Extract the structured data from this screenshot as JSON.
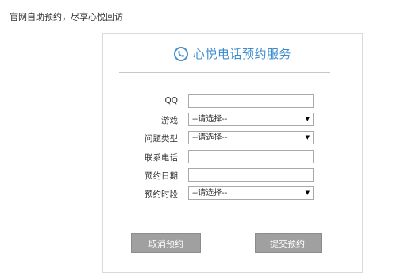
{
  "page": {
    "heading": "官网自助预约，尽享心悦回访"
  },
  "card": {
    "title": "心悦电话预约服务",
    "icon": "phone-icon",
    "accent_color": "#3e8ccf"
  },
  "form": {
    "qq": {
      "label": "QQ",
      "value": ""
    },
    "game": {
      "label": "游戏",
      "selected": "--请选择--"
    },
    "issue_type": {
      "label": "问题类型",
      "selected": "--请选择--"
    },
    "phone": {
      "label": "联系电话",
      "value": ""
    },
    "date": {
      "label": "预约日期",
      "value": ""
    },
    "time_slot": {
      "label": "预约时段",
      "selected": "--请选择--"
    }
  },
  "buttons": {
    "cancel": "取消预约",
    "submit": "提交预约"
  }
}
